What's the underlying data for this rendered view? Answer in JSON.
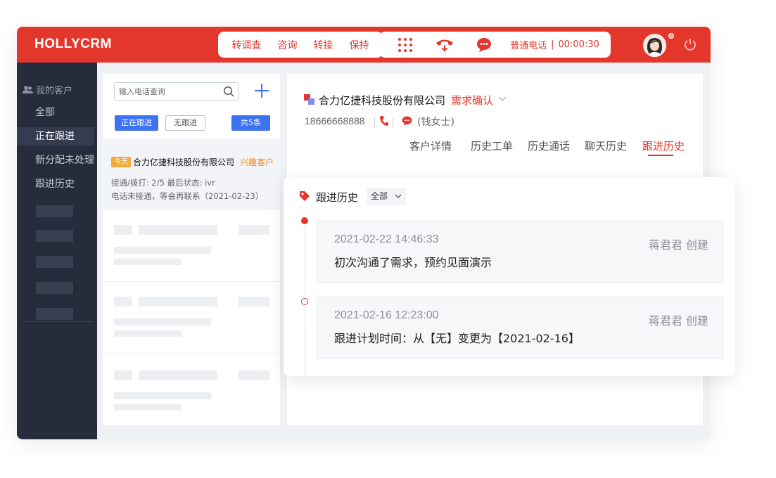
{
  "header": {
    "brand": "HOLLYCRM",
    "actions": [
      "转调查",
      "咨询",
      "转接",
      "保持"
    ],
    "call": {
      "type": "普通电话",
      "separator": "|",
      "duration": "00:00:30"
    }
  },
  "sidebar": {
    "title": "我的客户",
    "items": [
      {
        "label": "全部",
        "active": false
      },
      {
        "label": "正在跟进",
        "active": true
      },
      {
        "label": "新分配未处理",
        "active": false
      },
      {
        "label": "跟进历史",
        "active": false
      }
    ]
  },
  "list": {
    "search_placeholder": "输入电话查询",
    "filters": {
      "following": "正在跟进",
      "no_follow": "无跟进",
      "total": "共5条"
    },
    "first": {
      "badge": "今天",
      "company": "合力亿捷科技股份有限公司",
      "tag": "兴趣客户",
      "line1": "接通/拨打:  2/5   最后状态:  ivr",
      "line2": "电话未接通，等会再联系（2021-02-23）"
    }
  },
  "detail": {
    "company": "合力亿捷科技股份有限公司",
    "status": "需求确认",
    "phone": "18666668888",
    "contact": "(钱女士)",
    "tabs": [
      "客户详情",
      "历史工单",
      "历史通话",
      "聊天历史",
      "跟进历史"
    ],
    "active_tab": "跟进历史"
  },
  "history": {
    "title": "跟进历史",
    "filter": "全部",
    "entries": [
      {
        "time": "2021-02-22 14:46:33",
        "author": "蒋君君 创建",
        "text": "初次沟通了需求，预约见面演示"
      },
      {
        "time": "2021-02-16 12:23:00",
        "author": "蒋君君 创建",
        "text": "跟进计划时间：从【无】变更为【2021-02-16】"
      }
    ]
  },
  "colors": {
    "accent": "#e4372c",
    "primary": "#3d72f0",
    "sidebar": "#272c3d",
    "tag": "#f08a1e"
  }
}
